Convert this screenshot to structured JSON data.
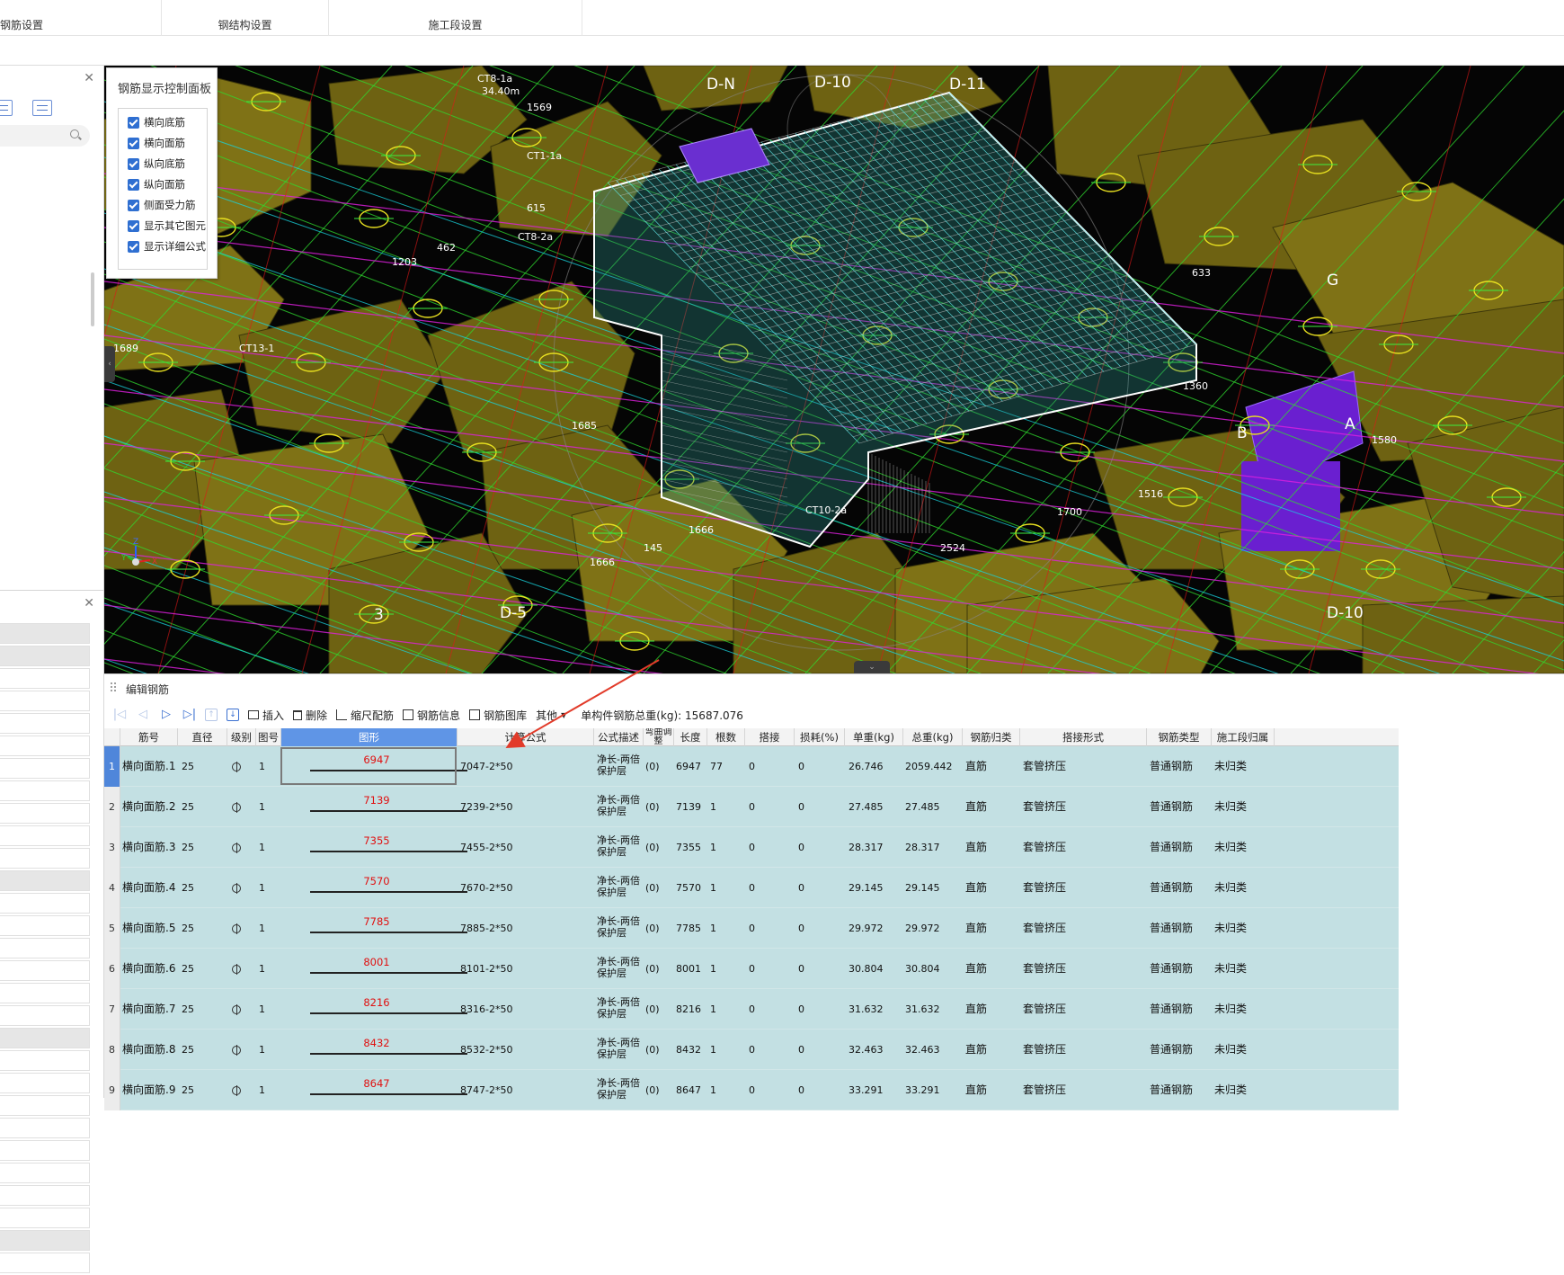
{
  "top_tabs": [
    "钢筋设置",
    "钢结构设置",
    "施工段设置"
  ],
  "control_panel": {
    "title": "钢筋显示控制面板",
    "options": [
      {
        "label": "横向底筋",
        "checked": true
      },
      {
        "label": "横向面筋",
        "checked": true
      },
      {
        "label": "纵向底筋",
        "checked": true
      },
      {
        "label": "纵向面筋",
        "checked": true
      },
      {
        "label": "侧面受力筋",
        "checked": true
      },
      {
        "label": "显示其它图元",
        "checked": true
      },
      {
        "label": "显示详细公式",
        "checked": true
      }
    ]
  },
  "viewport": {
    "axis_labels": [
      "D-N",
      "D-10",
      "D-11",
      "3",
      "D-5",
      "D-10",
      "A",
      "B",
      "G"
    ],
    "dimension_labels": [
      "CT8-1a",
      "34.40m",
      "1569",
      "1203",
      "462",
      "615",
      "1689",
      "CT13-1",
      "1685",
      "1666",
      "1666",
      "145",
      "2524",
      "1700",
      "1516",
      "1580",
      "633",
      "CT10-2a",
      "CT8-2a",
      "CT1-1a",
      "1360"
    ],
    "colors": {
      "footing": "#6e6212",
      "footing_top": "#7f7216",
      "cyan_line": "#18d6e0",
      "green_line": "#2fdc2f",
      "magenta_line": "#e020e0",
      "red_line": "#e01818",
      "purple_block": "#6a1fd0"
    }
  },
  "edit_panel": {
    "title": "编辑钢筋",
    "toolbar": {
      "insert": "插入",
      "delete": "删除",
      "scale": "缩尺配筋",
      "info": "钢筋信息",
      "library": "钢筋图库",
      "other": "其他",
      "total_weight": "单构件钢筋总重(kg): 15687.076"
    },
    "columns": [
      "筋号",
      "直径(mm)",
      "级别",
      "图号",
      "图形",
      "计算公式",
      "公式描述",
      "弯曲调整",
      "长度",
      "根数",
      "搭接",
      "损耗(%)",
      "单重(kg)",
      "总重(kg)",
      "钢筋归类",
      "搭接形式",
      "钢筋类型",
      "施工段归属"
    ],
    "rows": [
      {
        "n": "1",
        "name": "横向面筋.1",
        "dia": "25",
        "fig": "1",
        "shape": "6947",
        "formula": "7047-2*50",
        "desc1": "净长-两倍",
        "desc2": "保护层",
        "bend": "(0)",
        "len": "6947",
        "count": "77",
        "lap": "0",
        "loss": "0",
        "unit": "26.746",
        "total": "2059.442",
        "cls": "直筋",
        "lapform": "套管挤压",
        "type": "普通钢筋",
        "stage": "未归类"
      },
      {
        "n": "2",
        "name": "横向面筋.2",
        "dia": "25",
        "fig": "1",
        "shape": "7139",
        "formula": "7239-2*50",
        "desc1": "净长-两倍",
        "desc2": "保护层",
        "bend": "(0)",
        "len": "7139",
        "count": "1",
        "lap": "0",
        "loss": "0",
        "unit": "27.485",
        "total": "27.485",
        "cls": "直筋",
        "lapform": "套管挤压",
        "type": "普通钢筋",
        "stage": "未归类"
      },
      {
        "n": "3",
        "name": "横向面筋.3",
        "dia": "25",
        "fig": "1",
        "shape": "7355",
        "formula": "7455-2*50",
        "desc1": "净长-两倍",
        "desc2": "保护层",
        "bend": "(0)",
        "len": "7355",
        "count": "1",
        "lap": "0",
        "loss": "0",
        "unit": "28.317",
        "total": "28.317",
        "cls": "直筋",
        "lapform": "套管挤压",
        "type": "普通钢筋",
        "stage": "未归类"
      },
      {
        "n": "4",
        "name": "横向面筋.4",
        "dia": "25",
        "fig": "1",
        "shape": "7570",
        "formula": "7670-2*50",
        "desc1": "净长-两倍",
        "desc2": "保护层",
        "bend": "(0)",
        "len": "7570",
        "count": "1",
        "lap": "0",
        "loss": "0",
        "unit": "29.145",
        "total": "29.145",
        "cls": "直筋",
        "lapform": "套管挤压",
        "type": "普通钢筋",
        "stage": "未归类"
      },
      {
        "n": "5",
        "name": "横向面筋.5",
        "dia": "25",
        "fig": "1",
        "shape": "7785",
        "formula": "7885-2*50",
        "desc1": "净长-两倍",
        "desc2": "保护层",
        "bend": "(0)",
        "len": "7785",
        "count": "1",
        "lap": "0",
        "loss": "0",
        "unit": "29.972",
        "total": "29.972",
        "cls": "直筋",
        "lapform": "套管挤压",
        "type": "普通钢筋",
        "stage": "未归类"
      },
      {
        "n": "6",
        "name": "横向面筋.6",
        "dia": "25",
        "fig": "1",
        "shape": "8001",
        "formula": "8101-2*50",
        "desc1": "净长-两倍",
        "desc2": "保护层",
        "bend": "(0)",
        "len": "8001",
        "count": "1",
        "lap": "0",
        "loss": "0",
        "unit": "30.804",
        "total": "30.804",
        "cls": "直筋",
        "lapform": "套管挤压",
        "type": "普通钢筋",
        "stage": "未归类"
      },
      {
        "n": "7",
        "name": "横向面筋.7",
        "dia": "25",
        "fig": "1",
        "shape": "8216",
        "formula": "8316-2*50",
        "desc1": "净长-两倍",
        "desc2": "保护层",
        "bend": "(0)",
        "len": "8216",
        "count": "1",
        "lap": "0",
        "loss": "0",
        "unit": "31.632",
        "total": "31.632",
        "cls": "直筋",
        "lapform": "套管挤压",
        "type": "普通钢筋",
        "stage": "未归类"
      },
      {
        "n": "8",
        "name": "横向面筋.8",
        "dia": "25",
        "fig": "1",
        "shape": "8432",
        "formula": "8532-2*50",
        "desc1": "净长-两倍",
        "desc2": "保护层",
        "bend": "(0)",
        "len": "8432",
        "count": "1",
        "lap": "0",
        "loss": "0",
        "unit": "32.463",
        "total": "32.463",
        "cls": "直筋",
        "lapform": "套管挤压",
        "type": "普通钢筋",
        "stage": "未归类"
      },
      {
        "n": "9",
        "name": "横向面筋.9",
        "dia": "25",
        "fig": "1",
        "shape": "8647",
        "formula": "8747-2*50",
        "desc1": "净长-两倍",
        "desc2": "保护层",
        "bend": "(0)",
        "len": "8647",
        "count": "1",
        "lap": "0",
        "loss": "0",
        "unit": "33.291",
        "total": "33.291",
        "cls": "直筋",
        "lapform": "套管挤压",
        "type": "普通钢筋",
        "stage": "未归类"
      }
    ]
  }
}
